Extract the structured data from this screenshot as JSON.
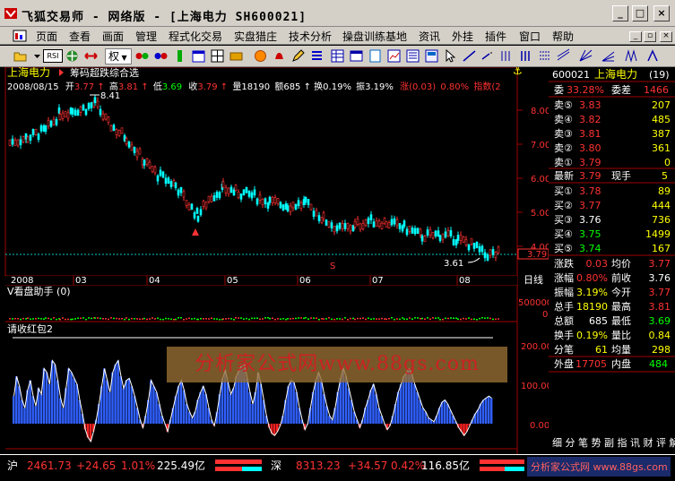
{
  "window": {
    "title": "飞狐交易师 - 网络版 - [上海电力 SH600021]",
    "minimize": "_",
    "maximize": "□",
    "close": "×"
  },
  "menu": [
    "页面",
    "查看",
    "画面",
    "管理",
    "程式化交易",
    "实盘猎庄",
    "技术分析",
    "操盘训练基地",
    "资讯",
    "外挂",
    "插件",
    "窗口",
    "帮助"
  ],
  "toolbar": {
    "quan_label": "权",
    "rsi_label": "RSI"
  },
  "chart": {
    "stock_name": "上海电力",
    "indicator_name": "筹码超跌综合选",
    "info_date": "2008/08/15",
    "info_open_label": "开",
    "info_open": "3.77",
    "info_high_label": "高",
    "info_high": "3.81",
    "info_low_label": "低",
    "info_low": "3.69",
    "info_close_label": "收",
    "info_close": "3.79",
    "info_vol_label": "量",
    "info_vol": "18190",
    "info_amt_label": "额",
    "info_amt": "685",
    "info_turn_label": "换",
    "info_turn": "0.19%",
    "info_amp_label": "振",
    "info_amp": "3.19%",
    "info_chg_label": "涨",
    "info_chg": "(0.03)",
    "info_chgpct": "0.80%",
    "info_idx_label": "指数",
    "info_idx": "(2",
    "high_marker": "8.41",
    "low_marker": "3.61",
    "last_price_tag": "3.79",
    "price_ticks": [
      "8.00",
      "7.00",
      "6.00",
      "5.00",
      "4.00"
    ],
    "sell_marker": "S",
    "x_labels": [
      "2008",
      "03",
      "04",
      "05",
      "06",
      "07",
      "08"
    ],
    "period_label": "日线",
    "vol_panel_title": "V看盘助手 (0)",
    "vol_ticks": [
      "500000",
      "0"
    ],
    "osc_panel_title": "请收红包2",
    "osc_ticks": [
      "200.00",
      "100.00",
      "0.00"
    ]
  },
  "chart_data": {
    "type": "bar",
    "title": "请收红包2",
    "ylim": [
      -50,
      270
    ],
    "values": [
      70,
      120,
      95,
      60,
      40,
      85,
      110,
      70,
      45,
      90,
      75,
      140,
      130,
      100,
      160,
      150,
      110,
      65,
      40,
      90,
      140,
      130,
      115,
      100,
      60,
      25,
      -15,
      -35,
      -45,
      -20,
      10,
      50,
      95,
      140,
      110,
      80,
      130,
      150,
      160,
      120,
      90,
      110,
      115,
      95,
      70,
      40,
      10,
      -10,
      20,
      60,
      110,
      95,
      80,
      50,
      20,
      0,
      -20,
      10,
      40,
      70,
      95,
      110,
      85,
      50,
      30,
      15,
      30,
      60,
      80,
      95,
      75,
      40,
      10,
      -5,
      30,
      75,
      115,
      135,
      105,
      75,
      90,
      120,
      135,
      150,
      150,
      115,
      80,
      50,
      80,
      130,
      100,
      60,
      20,
      -10,
      -25,
      -30,
      -20,
      -5,
      20,
      60,
      95,
      110,
      105,
      80,
      40,
      10,
      -15,
      0,
      40,
      80,
      110,
      130,
      110,
      75,
      45,
      20,
      10,
      40,
      80,
      115,
      140,
      120,
      90,
      60,
      30,
      10,
      -10,
      10,
      40,
      60,
      85,
      100,
      75,
      40,
      20,
      0,
      -15,
      -5,
      20,
      50,
      80,
      100,
      120,
      130,
      140,
      125,
      100,
      80,
      60,
      40,
      30,
      15,
      10,
      5,
      20,
      40,
      55,
      60,
      50,
      35,
      20,
      5,
      -10,
      -20,
      -30,
      -20,
      -5,
      10,
      25,
      35,
      50,
      60,
      65,
      70,
      65
    ]
  },
  "quote": {
    "code": "600021",
    "name": "上海电力",
    "count": "(19)",
    "webi_label": "委",
    "webi": "33.28%",
    "weicha_label": "委差",
    "weicha": "1466",
    "asks": [
      {
        "label": "卖⑤",
        "price": "3.83",
        "vol": "207"
      },
      {
        "label": "卖④",
        "price": "3.82",
        "vol": "485"
      },
      {
        "label": "卖③",
        "price": "3.81",
        "vol": "387"
      },
      {
        "label": "卖②",
        "price": "3.80",
        "vol": "361"
      },
      {
        "label": "卖①",
        "price": "3.79",
        "vol": "0"
      }
    ],
    "last_label": "最新",
    "last": "3.79",
    "curvol_label": "现手",
    "curvol": "5",
    "bids": [
      {
        "label": "买①",
        "price": "3.78",
        "vol": "89"
      },
      {
        "label": "买②",
        "price": "3.77",
        "vol": "444"
      },
      {
        "label": "买③",
        "price": "3.76",
        "vol": "736"
      },
      {
        "label": "买④",
        "price": "3.75",
        "vol": "1499"
      },
      {
        "label": "买⑤",
        "price": "3.74",
        "vol": "167"
      }
    ],
    "stats": [
      {
        "l1": "涨跌",
        "v1": "0.03",
        "l2": "均价",
        "v2": "3.77"
      },
      {
        "l1": "涨幅",
        "v1": "0.80%",
        "l2": "前收",
        "v2": "3.76"
      },
      {
        "l1": "振幅",
        "v1": "3.19%",
        "l2": "今开",
        "v2": "3.77"
      },
      {
        "l1": "总手",
        "v1": "18190",
        "l2": "最高",
        "v2": "3.81"
      },
      {
        "l1": "总额",
        "v1": "685",
        "l2": "最低",
        "v2": "3.69"
      },
      {
        "l1": "换手",
        "v1": "0.19%",
        "l2": "量比",
        "v2": "0.84"
      },
      {
        "l1": "分笔",
        "v1": "61",
        "l2": "均量",
        "v2": "298"
      }
    ],
    "waipan_label": "外盘",
    "waipan": "17705",
    "neipan_label": "内盘",
    "neipan": "484",
    "tabs_text": "细 分 笔 势 副 指 讯 财 评 解"
  },
  "status": {
    "sh_label": "沪",
    "sh_index": "2461.73",
    "sh_chg": "+24.65",
    "sh_pct": "1.01%",
    "sh_amt": "225.49亿",
    "sz_label": "深",
    "sz_index": "8313.23",
    "sz_chg": "+34.57",
    "sz_pct": "0.42%",
    "sz_amt": "116.85亿"
  },
  "watermark": {
    "main": "分析家公式网www.88gs.com",
    "corner": "分析家公式网 www.88gs.com"
  },
  "colors": {
    "up": "#ff3232",
    "down": "#00ffff",
    "bar_blue": "#3060ff",
    "yellow": "#ffff00"
  }
}
